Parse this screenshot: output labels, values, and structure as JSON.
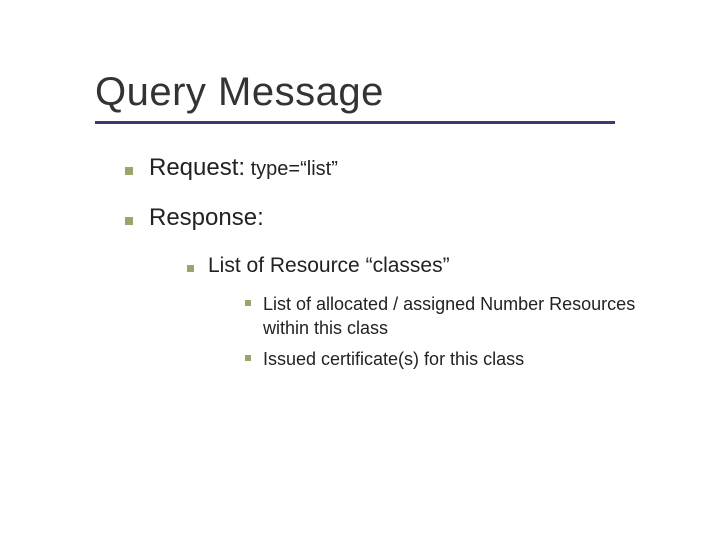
{
  "title": "Query Message",
  "items": [
    {
      "label": "Request:",
      "sub": " type=“list”"
    },
    {
      "label": "Response:",
      "children": [
        {
          "label": "List of Resource “classes”",
          "children": [
            {
              "label": "List of allocated / assigned Number Resources within this class"
            },
            {
              "label": "Issued certificate(s) for this class"
            }
          ]
        }
      ]
    }
  ],
  "colors": {
    "rule": "#3e3774",
    "bullet": "#9fa26d"
  }
}
